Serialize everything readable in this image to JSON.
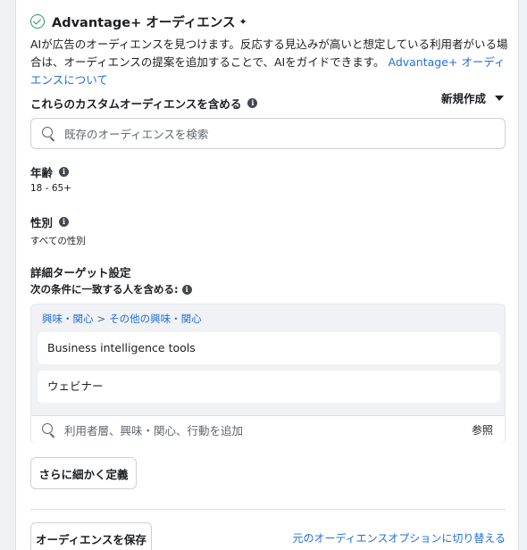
{
  "header": {
    "title": "Advantage+ オーディエンス",
    "description": "AIが広告のオーディエンスを見つけます。反応する見込みが高いと想定している利用者がいる場合は、オーディエンスの提案を追加することで、AIをガイドできます。",
    "link": "Advantage+ オーディエンスについて"
  },
  "custom_audience": {
    "label": "これらのカスタムオーディエンスを含める",
    "new_button": "新規作成",
    "search_placeholder": "既存のオーディエンスを検索"
  },
  "age": {
    "label": "年齢",
    "value": "18 - 65+"
  },
  "gender": {
    "label": "性別",
    "value": "すべての性別"
  },
  "detailed_targeting": {
    "label": "詳細ターゲット設定",
    "sublabel": "次の条件に一致する人を含める:",
    "breadcrumb": [
      "興味・関心",
      "その他の興味・関心"
    ],
    "breadcrumb_sep": ">",
    "items": [
      "Business intelligence tools",
      "ウェビナー"
    ],
    "add_placeholder": "利用者層、興味・関心、行動を追加",
    "browse": "参照"
  },
  "refine_button": "さらに細かく定義",
  "save_button": "オーディエンスを保存",
  "switch_link": "元のオーディエンスオプションに切り替える",
  "colors": {
    "accent": "#216fdb",
    "success": "#1a9e5c"
  }
}
